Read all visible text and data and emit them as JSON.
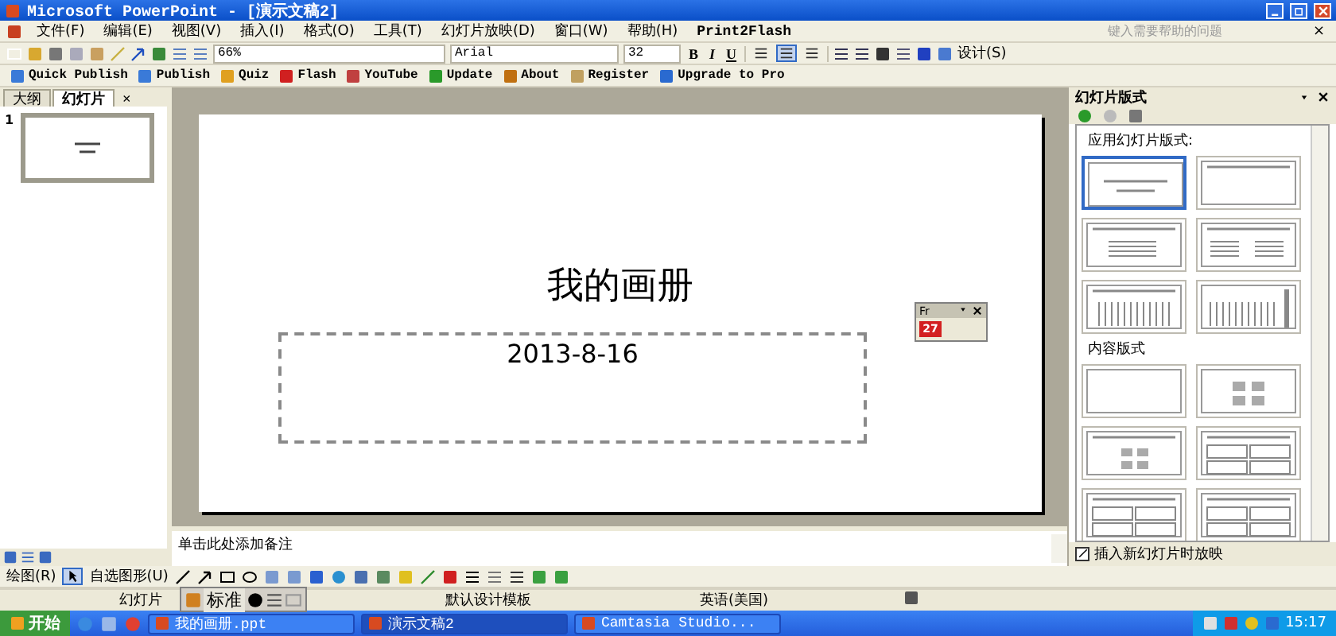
{
  "window": {
    "title": "Microsoft PowerPoint - [演示文稿2]"
  },
  "menu": {
    "items": [
      "文件(F)",
      "编辑(E)",
      "视图(V)",
      "插入(I)",
      "格式(O)",
      "工具(T)",
      "幻灯片放映(D)",
      "窗口(W)",
      "帮助(H)",
      "Print2Flash"
    ],
    "help_placeholder": "键入需要帮助的问题",
    "close": "×"
  },
  "format_toolbar": {
    "zoom": "66%",
    "font": "Arial",
    "size": "32",
    "styles": [
      "B",
      "I",
      "U"
    ],
    "align": [
      {
        "selected": false
      },
      {
        "selected": true
      },
      {
        "selected": false
      }
    ],
    "design": "设计(S)"
  },
  "publish_toolbar": [
    "Quick Publish",
    "Publish",
    "Quiz",
    "Flash",
    "YouTube",
    "Update",
    "About",
    "Register",
    "Upgrade to Pro"
  ],
  "pane_tabs": [
    {
      "label": "大纲",
      "selected": false
    },
    {
      "label": "幻灯片",
      "selected": true
    }
  ],
  "pane_close": "×",
  "thumbnails": [
    {
      "number": "1",
      "selected": true
    }
  ],
  "slide": {
    "title": "我的画册",
    "subtitle": "2013-8-16",
    "subtitle_selected": true
  },
  "float_toolbar": {
    "title": "Fr",
    "badge": "27"
  },
  "notes_prompt": "单击此处添加备注",
  "task_pane": {
    "title": "幻灯片版式",
    "sections": [
      {
        "heading": "应用幻灯片版式:",
        "layouts": [
          {
            "kind": "title",
            "selected": true
          },
          {
            "kind": "title_only",
            "selected": false
          },
          {
            "kind": "text",
            "selected": false
          },
          {
            "kind": "two_text",
            "selected": false
          },
          {
            "kind": "vtext",
            "selected": false
          },
          {
            "kind": "vtext_side",
            "selected": false
          }
        ]
      },
      {
        "heading": "内容版式",
        "layouts": [
          {
            "kind": "blank",
            "selected": false
          },
          {
            "kind": "content",
            "selected": false
          },
          {
            "kind": "title_content",
            "selected": false
          },
          {
            "kind": "four_content",
            "selected": false
          },
          {
            "kind": "four_content",
            "selected": false
          },
          {
            "kind": "four_content",
            "selected": false
          }
        ]
      }
    ],
    "show_on_insert": {
      "label": "插入新幻灯片时放映",
      "checked": true
    }
  },
  "drawing_toolbar": {
    "draw": "绘图(R)",
    "autoshapes": "自选图形(U)"
  },
  "status_bar": {
    "slide": "幻灯片",
    "template": "默认设计模板",
    "language": "英语(美国)"
  },
  "ime_bar": {
    "mode": "标准"
  },
  "taskbar": {
    "start": "开始",
    "tasks": [
      {
        "label": "我的画册.ppt",
        "selected": false
      },
      {
        "label": "演示文稿2",
        "selected": true
      },
      {
        "label": "Camtasia Studio...",
        "selected": false
      }
    ],
    "clock": "15:17"
  }
}
